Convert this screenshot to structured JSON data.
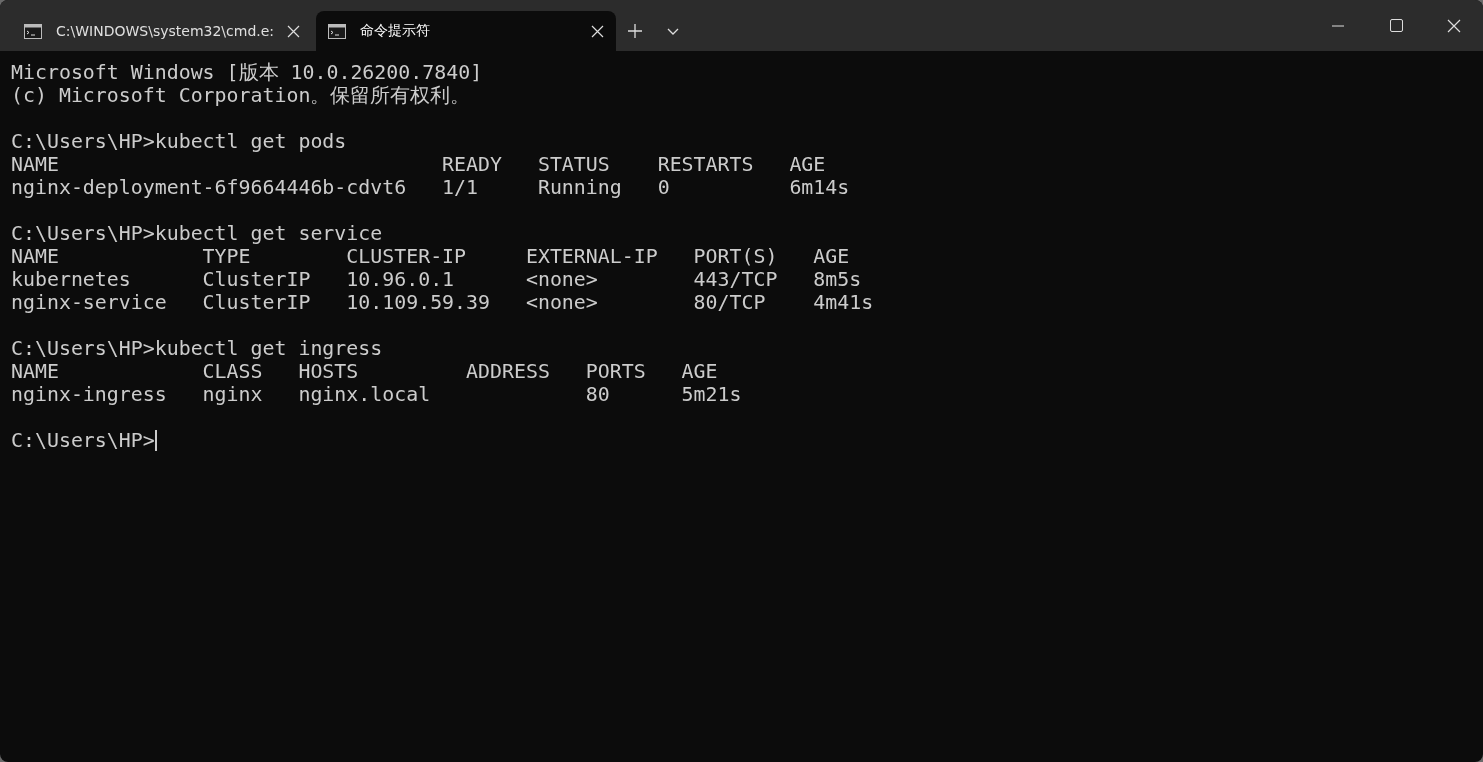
{
  "tabs": [
    {
      "title": "C:\\WINDOWS\\system32\\cmd.e:",
      "selected": false
    },
    {
      "title": "命令提示符",
      "selected": true
    }
  ],
  "terminal": {
    "blocks": [
      {
        "lines": [
          "Microsoft Windows [版本 10.0.26200.7840]",
          "(c) Microsoft Corporation。保留所有权利。"
        ],
        "cursor": false
      },
      {
        "lines": [
          "C:\\Users\\HP>kubectl get pods",
          "NAME                                READY   STATUS    RESTARTS   AGE",
          "nginx-deployment-6f9664446b-cdvt6   1/1     Running   0          6m14s"
        ],
        "cursor": false
      },
      {
        "lines": [
          "C:\\Users\\HP>kubectl get service",
          "NAME            TYPE        CLUSTER-IP     EXTERNAL-IP   PORT(S)   AGE",
          "kubernetes      ClusterIP   10.96.0.1      <none>        443/TCP   8m5s",
          "nginx-service   ClusterIP   10.109.59.39   <none>        80/TCP    4m41s"
        ],
        "cursor": false
      },
      {
        "lines": [
          "C:\\Users\\HP>kubectl get ingress",
          "NAME            CLASS   HOSTS         ADDRESS   PORTS   AGE",
          "nginx-ingress   nginx   nginx.local             80      5m21s"
        ],
        "cursor": false
      },
      {
        "lines": [
          "C:\\Users\\HP>"
        ],
        "cursor": true
      }
    ]
  }
}
